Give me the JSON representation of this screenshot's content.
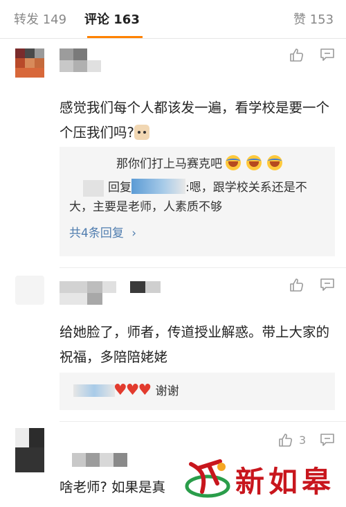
{
  "tabs": {
    "reposts": "转发 149",
    "comments": "评论 163",
    "likes": "赞 153"
  },
  "comments": [
    {
      "text": "感觉我们每个人都该发一遍，看学校是要一个个压我们吗?",
      "replies": {
        "line1": "那你们打上马赛克吧",
        "line2_prefix": "回复",
        "line2_suffix": ":嗯，跟学校关系还是不",
        "line3": "大，主要是老师，人素质不够",
        "more": "共4条回复",
        "more_icon": "chevron-right-icon"
      }
    },
    {
      "text": "给她脸了，师者，传道授业解惑。带上大家的祝福，多陪陪姥姥",
      "reply_text": "谢谢"
    },
    {
      "like_count": "3",
      "text_partial": "啥老师? 如果是真"
    }
  ],
  "watermark": {
    "text": "新如皋"
  },
  "colors": {
    "accent": "#ff8200",
    "link": "#507daf",
    "brand_red": "#c8161d"
  }
}
